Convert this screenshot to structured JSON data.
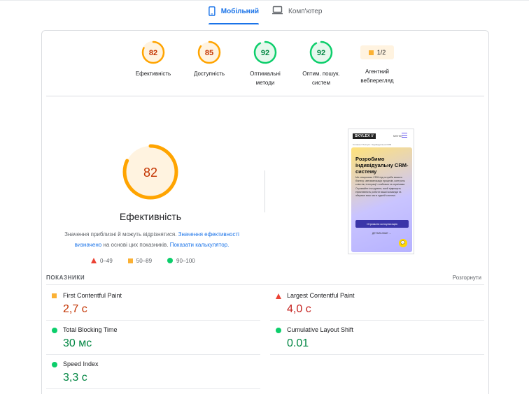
{
  "tabs": {
    "mobile_label": "Мобільний",
    "desktop_label": "Комп'ютер"
  },
  "gauges": [
    {
      "score": "82",
      "label": "Ефективність",
      "status": "average",
      "value": 82
    },
    {
      "score": "85",
      "label": "Доступність",
      "status": "average",
      "value": 85
    },
    {
      "score": "92",
      "label_line1": "Оптимальні",
      "label_line2": "методи",
      "status": "pass",
      "value": 92
    },
    {
      "score": "92",
      "label_line1": "Оптим. пошук.",
      "label_line2": "систем",
      "status": "pass",
      "value": 92
    }
  ],
  "pwa": {
    "badge": "1/2",
    "label_line1": "Агентний",
    "label_line2": "веб­перегляд"
  },
  "main": {
    "score": "82",
    "score_value": 82,
    "title": "Ефективність",
    "disclaimer_text1": "Значення приблизні й можуть відрізнятися. ",
    "disclaimer_link1": "Значення ефективності визначено",
    "disclaimer_text2": " на основі цих показників. ",
    "disclaimer_link2": "Показати калькулятор.",
    "legend": {
      "fail": "0–49",
      "average": "50–89",
      "pass": "90–100"
    }
  },
  "screenshot": {
    "logo": "SKYLEX //",
    "menu_text": "МЕНЮ",
    "breadcrumbs": "Головна  /  Послуги  /  Індивідуальна CRM",
    "heading": "Розробимо індивідуальну CRM-систему",
    "paragraph": "Ми створюємо CRM під потреби вашого бізнесу: автоматизація процесів, контроль клієнтів, інтеграції з сайтами та сервісами. Отримайте інструмент, який підвищить ефективність роботи вашої команди та збереже ваш час в єдиній системі.",
    "button": "Отримати консультацію",
    "link": "ДЕТАЛЬНІШЕ →",
    "chat_icon": "chat-icon"
  },
  "metrics": {
    "title": "ПОКАЗНИКИ",
    "expand": "Розгорнути",
    "items": [
      {
        "name": "First Contentful Paint",
        "value": "2,7 с",
        "status": "average"
      },
      {
        "name": "Largest Contentful Paint",
        "value": "4,0 с",
        "status": "fail"
      },
      {
        "name": "Total Blocking Time",
        "value": "30 мс",
        "status": "pass"
      },
      {
        "name": "Cumulative Layout Shift",
        "value": "0.01",
        "status": "pass"
      },
      {
        "name": "Speed Index",
        "value": "3,3 с",
        "status": "pass"
      }
    ]
  },
  "colors": {
    "average": "#ffa400",
    "average_text": "#c33300",
    "pass": "#0cce6b",
    "pass_text": "#018642",
    "fail": "#eb4335",
    "accent": "#1a73e8"
  }
}
